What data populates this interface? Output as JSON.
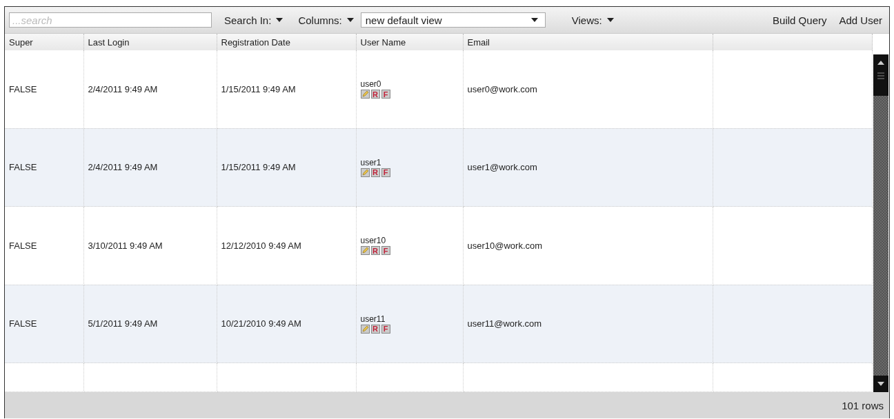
{
  "toolbar": {
    "search": {
      "placeholder": "...search"
    },
    "menus": [
      "Search In:",
      "Columns:"
    ],
    "view_select": {
      "value": "new default view"
    },
    "views_menu": "Views:",
    "actions": [
      "Build Query",
      "Add User"
    ]
  },
  "table": {
    "columns": [
      "Super",
      "Last Login",
      "Registration Date",
      "User Name",
      "Email"
    ],
    "rows": [
      {
        "super": "FALSE",
        "last_login": "2/4/2011 9:49 AM",
        "registration_date": "1/15/2011 9:49 AM",
        "user_name": "user0",
        "buttons": [
          "R",
          "F"
        ],
        "email": "user0@work.com"
      },
      {
        "super": "FALSE",
        "last_login": "2/4/2011 9:49 AM",
        "registration_date": "1/15/2011 9:49 AM",
        "user_name": "user1",
        "buttons": [
          "R",
          "F"
        ],
        "email": "user1@work.com"
      },
      {
        "super": "FALSE",
        "last_login": "3/10/2011 9:49 AM",
        "registration_date": "12/12/2010 9:49 AM",
        "user_name": "user10",
        "buttons": [
          "R",
          "F"
        ],
        "email": "user10@work.com"
      },
      {
        "super": "FALSE",
        "last_login": "5/1/2011 9:49 AM",
        "registration_date": "10/21/2010 9:49 AM",
        "user_name": "user11",
        "buttons": [
          "R",
          "F"
        ],
        "email": "user11@work.com"
      }
    ]
  },
  "status_bar": {
    "row_count": "101 rows"
  }
}
